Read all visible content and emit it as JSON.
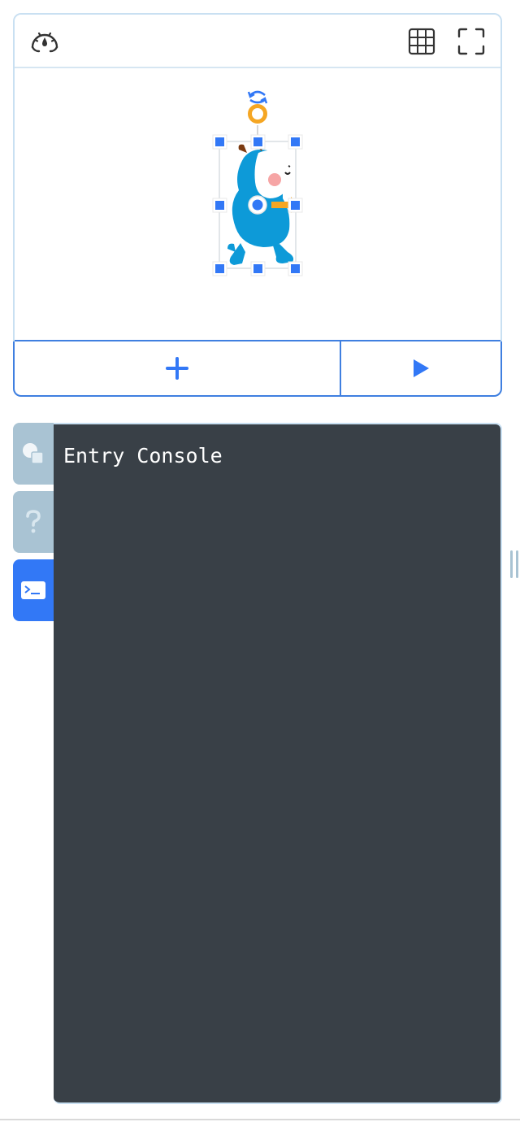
{
  "stage": {
    "toolbar": {
      "speed_icon": "speedometer-icon",
      "grid_icon": "grid-icon",
      "fullscreen_icon": "fullscreen-icon"
    },
    "sprite": {
      "name_icon": "entry-bot-sprite",
      "handle_color": "#3278f6",
      "rotation_color": "#f5a623",
      "body_color": "#0d8fd6"
    },
    "add_icon": "plus-icon",
    "run_icon": "play-icon"
  },
  "side_tabs": [
    {
      "icon": "objects-icon",
      "active": false
    },
    {
      "icon": "help-icon",
      "active": false
    },
    {
      "icon": "console-icon",
      "active": true
    }
  ],
  "console": {
    "text": "Entry Console"
  },
  "colors": {
    "accent": "#3278f6",
    "panel_border": "#c9e0f2",
    "tab_inactive": "#a9c3d3",
    "console_bg": "#394047"
  }
}
